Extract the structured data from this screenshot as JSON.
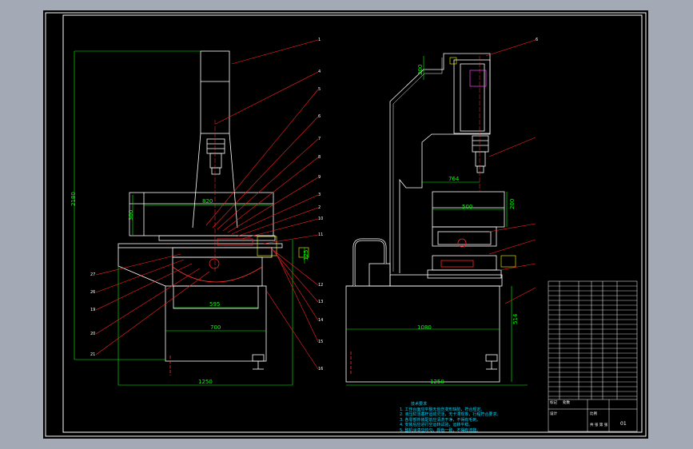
{
  "drawing": {
    "left_view": {
      "dimensions": {
        "width_820": "820",
        "height_300": "300",
        "width_595": "595",
        "width_700": "700",
        "width_1250": "1250",
        "height_2180": "2180",
        "height_125": "125"
      },
      "part_labels": [
        "1",
        "4",
        "5",
        "6",
        "7",
        "8",
        "9",
        "3",
        "2",
        "10",
        "11",
        "27",
        "26",
        "19",
        "20",
        "21",
        "12",
        "13",
        "14",
        "15",
        "16"
      ]
    },
    "right_view": {
      "dimensions": {
        "height_200": "200",
        "width_764": "764",
        "width_500": "500",
        "height_200b": "200",
        "width_1080": "1080",
        "height_514": "514",
        "width_1250": "1250"
      },
      "part_labels": [
        "6"
      ]
    },
    "notes": {
      "title": "技术要求",
      "lines": [
        "1. 工作台面应平整无划伤变形缺陷，符合规定。",
        "2. 液压缸活塞杆运动灵活，无卡滞现象，行程符合要求。",
        "3. 各零部件装配前应清洗干净，不得有毛刺。",
        "4. 安装后应进行空运转试验，运转平稳。",
        "5. 整机涂漆应均匀，颜色一致，不得有流挂。"
      ]
    },
    "title_block": {
      "mark": "标记",
      "count": "处数",
      "design": "设计",
      "drawing_no": "01",
      "scale": "比例",
      "sheet": "共 张 第 张"
    }
  }
}
